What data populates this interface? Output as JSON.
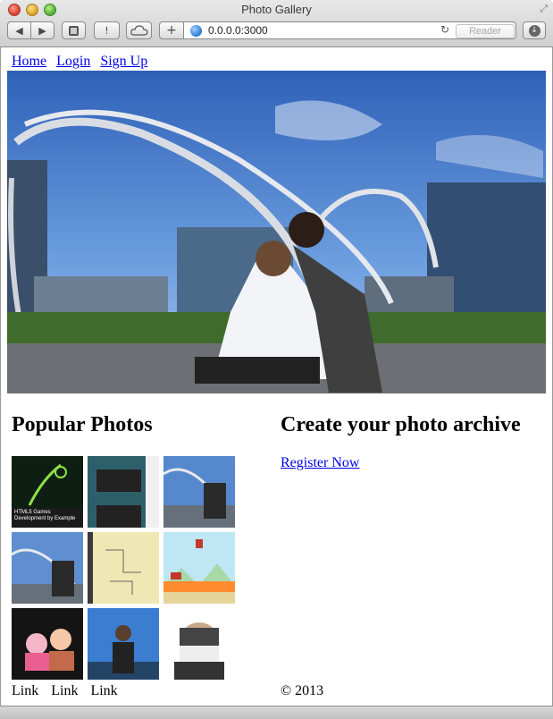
{
  "browser": {
    "window_title": "Photo Gallery",
    "url": "0.0.0.0:3000",
    "reader_label": "Reader",
    "back_label": "◀",
    "forward_label": "▶",
    "warn_label": "!",
    "add_label": "+",
    "reload_label": "↻"
  },
  "nav": {
    "items": [
      {
        "label": "Home"
      },
      {
        "label": "Login"
      },
      {
        "label": "Sign Up"
      }
    ]
  },
  "popular": {
    "heading": "Popular Photos",
    "links": [
      "Link",
      "Link",
      "Link"
    ],
    "thumb1_text": "HTML5 Games Development by Example"
  },
  "archive": {
    "heading": "Create your photo archive",
    "register_label": "Register Now",
    "copyright": "© 2013"
  },
  "colors": {
    "link": "#0000ee",
    "sky": "#3d6fc0"
  }
}
